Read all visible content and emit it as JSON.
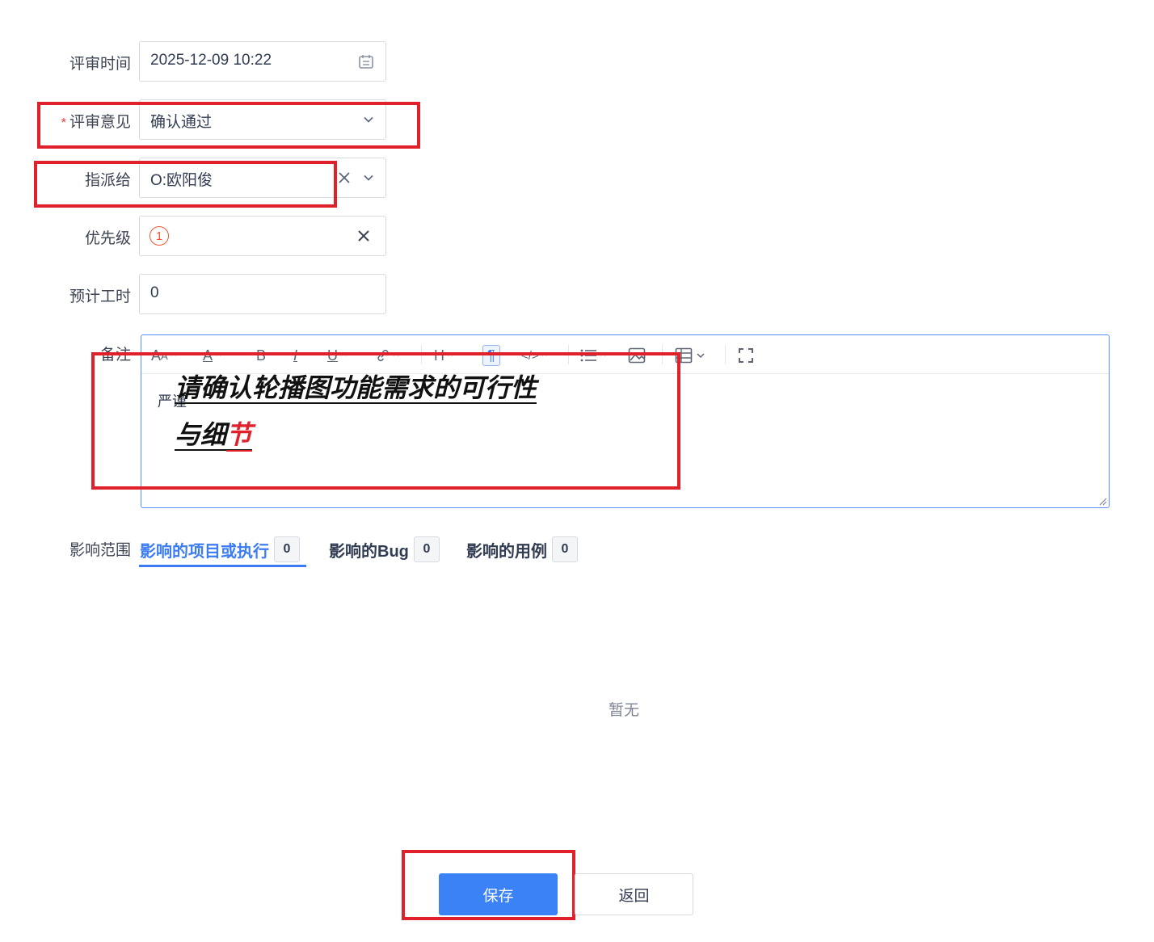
{
  "form": {
    "review_time": {
      "label": "评审时间",
      "value": "2025-12-09 10:22"
    },
    "review_opinion": {
      "required_mark": "*",
      "label": "评审意见",
      "value": "确认通过"
    },
    "assign_to": {
      "label": "指派给",
      "value": "O:欧阳俊"
    },
    "priority": {
      "label": "优先级",
      "value": "1"
    },
    "estimate": {
      "label": "预计工时",
      "value": "0"
    },
    "remark": {
      "label": "备注",
      "content": "严谨",
      "toolbar": [
        "font-size",
        "font-color",
        "bold",
        "italic",
        "underline",
        "link",
        "heading",
        "paragraph",
        "code",
        "list",
        "image",
        "table",
        "fullscreen"
      ]
    }
  },
  "annotation": {
    "line1": "请确认轮播图功能需求的可行性",
    "line2_prefix": "与细",
    "line2_red": "节"
  },
  "impact": {
    "label": "影响范围",
    "tabs": [
      {
        "label": "影响的项目或执行",
        "count": "0",
        "active": true
      },
      {
        "label": "影响的Bug",
        "count": "0",
        "active": false
      },
      {
        "label": "影响的用例",
        "count": "0",
        "active": false
      }
    ],
    "empty_text": "暂无"
  },
  "actions": {
    "save": "保存",
    "back": "返回"
  },
  "colors": {
    "accent": "#3b82f6",
    "annotation_red": "#e0202a",
    "priority_icon": "#f0552f"
  }
}
